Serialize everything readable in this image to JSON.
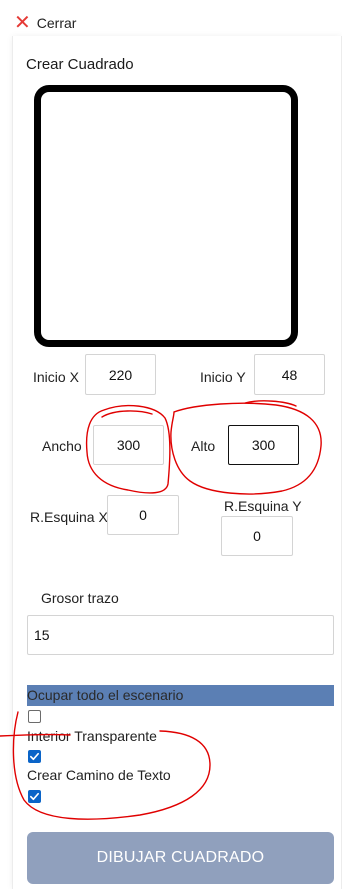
{
  "close": {
    "label": "Cerrar"
  },
  "dialog": {
    "title": "Crear Cuadrado"
  },
  "fields": {
    "inicio_x": {
      "label": "Inicio X",
      "value": "220"
    },
    "inicio_y": {
      "label": "Inicio Y",
      "value": "48"
    },
    "ancho": {
      "label": "Ancho",
      "value": "300"
    },
    "alto": {
      "label": "Alto",
      "value": "300"
    },
    "resquina_x": {
      "label": "R.Esquina X",
      "value": "0"
    },
    "resquina_y": {
      "label": "R.Esquina Y",
      "value": "0"
    },
    "grosor": {
      "label": "Grosor trazo",
      "value": "15"
    }
  },
  "options": {
    "ocupar": {
      "label": "Ocupar todo el escenario",
      "checked": false
    },
    "interior": {
      "label": "Interior Transparente",
      "checked": true
    },
    "camino": {
      "label": "Crear Camino de Texto",
      "checked": true
    }
  },
  "submit": {
    "label": "DIBUJAR CUADRADO"
  },
  "colors": {
    "accent_bar": "#5b7fb4",
    "button_disabled": "#90a0bd",
    "close_icon": "#e53935",
    "annotation": "#e00000",
    "checkbox_checked": "#0a64c8"
  }
}
